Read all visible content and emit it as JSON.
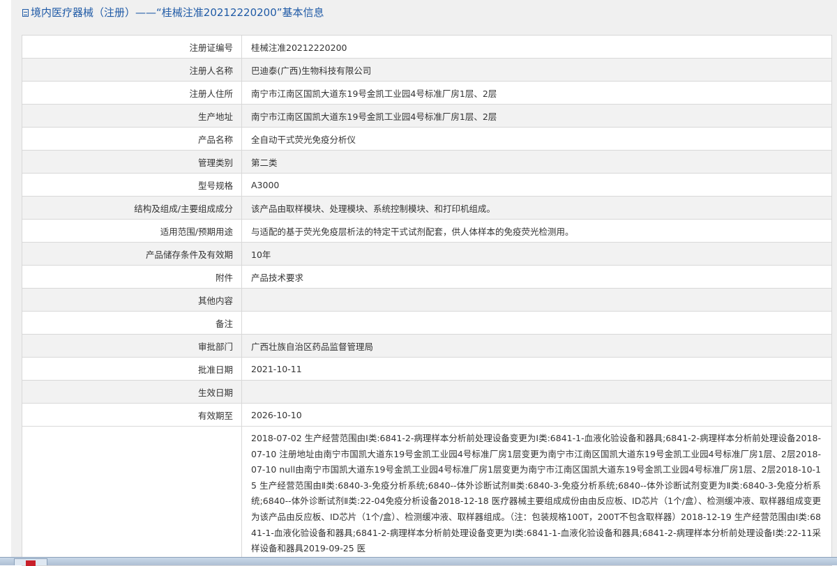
{
  "header": {
    "title": "境内医疗器械（注册）——“桂械注准20212220200”基本信息"
  },
  "rows": [
    {
      "label": "注册证编号",
      "value": "桂械注准20212220200"
    },
    {
      "label": "注册人名称",
      "value": "巴迪泰(广西)生物科技有限公司"
    },
    {
      "label": "注册人住所",
      "value": "南宁市江南区国凯大道东19号金凯工业园4号标准厂房1层、2层"
    },
    {
      "label": "生产地址",
      "value": "南宁市江南区国凯大道东19号金凯工业园4号标准厂房1层、2层"
    },
    {
      "label": "产品名称",
      "value": "全自动干式荧光免疫分析仪"
    },
    {
      "label": "管理类别",
      "value": "第二类"
    },
    {
      "label": "型号规格",
      "value": "A3000"
    },
    {
      "label": "结构及组成/主要组成成分",
      "value": "该产品由取样模块、处理模块、系统控制模块、和打印机组成。"
    },
    {
      "label": "适用范围/预期用途",
      "value": "与适配的基于荧光免疫层析法的特定干式试剂配套，供人体样本的免疫荧光检测用。"
    },
    {
      "label": "产品储存条件及有效期",
      "value": "10年"
    },
    {
      "label": "附件",
      "value": "产品技术要求"
    },
    {
      "label": "其他内容",
      "value": ""
    },
    {
      "label": "备注",
      "value": ""
    },
    {
      "label": "审批部门",
      "value": "广西壮族自治区药品监督管理局"
    },
    {
      "label": "批准日期",
      "value": "2021-10-11"
    },
    {
      "label": "生效日期",
      "value": ""
    },
    {
      "label": "有效期至",
      "value": "2026-10-10"
    }
  ],
  "change_history": {
    "label": "",
    "text": "2018-07-02 生产经营范围由Ⅰ类:6841-2-病理样本分析前处理设备变更为Ⅰ类:6841-1-血液化验设备和器具;6841-2-病理样本分析前处理设备2018-07-10 注册地址由南宁市国凯大道东19号金凯工业园4号标准厂房1层变更为南宁市江南区国凯大道东19号金凯工业园4号标准厂房1层、2层2018-07-10 null由南宁市国凯大道东19号金凯工业园4号标准厂房1层变更为南宁市江南区国凯大道东19号金凯工业园4号标准厂房1层、2层2018-10-15 生产经营范围由Ⅱ类:6840-3-免疫分析系统;6840--体外诊断试剂Ⅲ类:6840-3-免疫分析系统;6840--体外诊断试剂变更为Ⅱ类:6840-3-免疫分析系统;6840--体外诊断试剂Ⅱ类:22-04免疫分析设备2018-12-18 医疗器械主要组成成份由由反应板、ID芯片（1个/盒）、检测缓冲液、取样器组成变更为该产品由反应板、ID芯片（1个/盒）、检测缓冲液、取样器组成。（注：包装规格100T，200T不包含取样器）2018-12-19 生产经营范围由Ⅰ类:6841-1-血液化验设备和器具;6841-2-病理样本分析前处理设备变更为Ⅰ类:6841-1-血液化验设备和器具;6841-2-病理样本分析前处理设备Ⅰ类:22-11采样设备和器具2019-09-25 医"
  }
}
